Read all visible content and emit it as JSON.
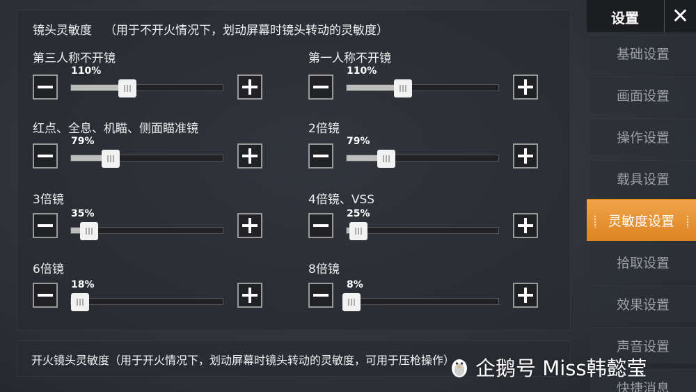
{
  "main": {
    "section_title": "镜头灵敏度",
    "section_subtitle": "（用于不开火情况下，划动屏幕时镜头转动的灵敏度）",
    "groups": [
      {
        "label": "第三人称不开镜",
        "value": "110%",
        "fraction": 0.37
      },
      {
        "label": "第一人称不开镜",
        "value": "110%",
        "fraction": 0.37
      },
      {
        "label": "红点、全息、机瞄、侧面瞄准镜",
        "value": "79%",
        "fraction": 0.26
      },
      {
        "label": "2倍镜",
        "value": "79%",
        "fraction": 0.26
      },
      {
        "label": "3倍镜",
        "value": "35%",
        "fraction": 0.12
      },
      {
        "label": "4倍镜、VSS",
        "value": "25%",
        "fraction": 0.08
      },
      {
        "label": "6倍镜",
        "value": "18%",
        "fraction": 0.06
      },
      {
        "label": "8倍镜",
        "value": "8%",
        "fraction": 0.03
      }
    ],
    "bottom_text": "开火镜头灵敏度（用于开火情况下，划动屏幕时镜头转动的灵敏度，可用于压枪操作）"
  },
  "sidebar": {
    "title": "设置",
    "close_icon": "close-icon",
    "items": [
      {
        "label": "基础设置"
      },
      {
        "label": "画面设置"
      },
      {
        "label": "操作设置"
      },
      {
        "label": "载具设置"
      },
      {
        "label": "灵敏度设置"
      },
      {
        "label": "拾取设置"
      },
      {
        "label": "效果设置"
      },
      {
        "label": "声音设置"
      },
      {
        "label": "快捷消息"
      }
    ],
    "active_index": 4
  },
  "watermark": {
    "text": "企鹅号 Miss韩懿莹"
  },
  "colors": {
    "accent": "#e89236",
    "panel": "#2d3037",
    "nav_text": "#9b9ea5"
  }
}
